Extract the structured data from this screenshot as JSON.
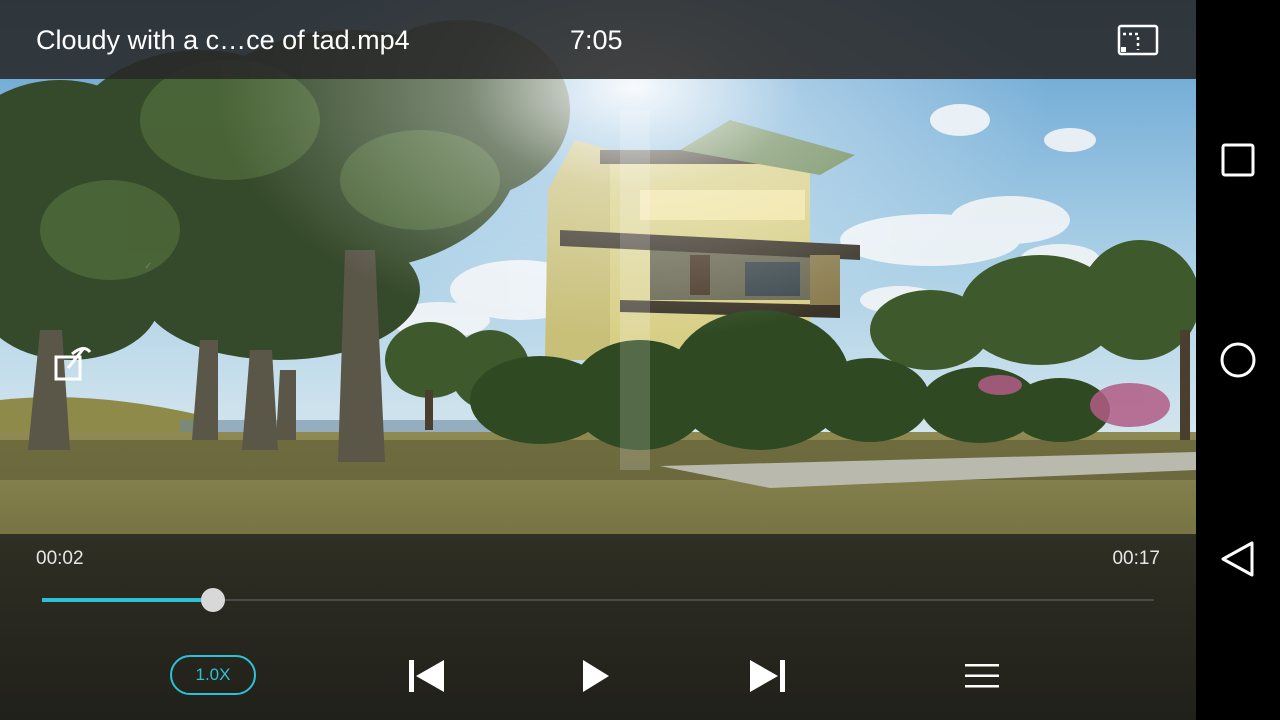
{
  "header": {
    "title": "Cloudy with a c…ce of tad.mp4",
    "clock": "7:05",
    "cast_icon": "cast-icon"
  },
  "overlay": {
    "rotate_lock_icon": "screen-rotation-lock-icon"
  },
  "player": {
    "elapsed": "00:02",
    "duration": "00:17",
    "progress_fraction": 0.154,
    "speed_label": "1.0X",
    "accent_color": "#2cc1d6",
    "controls": {
      "previous_icon": "skip-previous-icon",
      "play_icon": "play-icon",
      "next_icon": "skip-next-icon",
      "playlist_icon": "playlist-menu-icon"
    }
  },
  "navigation_bar": {
    "recents_icon": "square-recents-icon",
    "home_icon": "circle-home-icon",
    "back_icon": "triangle-back-icon"
  }
}
